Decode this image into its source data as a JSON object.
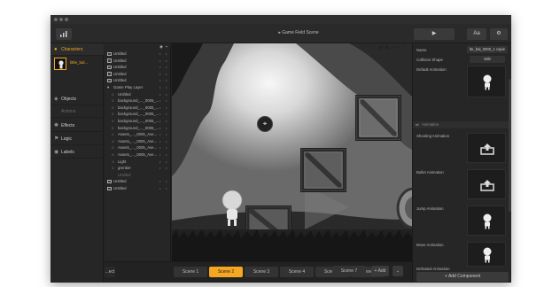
{
  "toolbar": {
    "scene_title": "Game Field Scene",
    "left_icon": "chart-icon",
    "play_icon": "play-icon",
    "text_label": "Aa",
    "settings_icon": "gear-icon"
  },
  "left_panel": {
    "items": [
      {
        "label": "Characters",
        "icon": "person-icon",
        "active": true
      },
      {
        "label": "Objects",
        "icon": "cube-icon"
      },
      {
        "label": "Actions",
        "icon": "none"
      },
      {
        "label": "Effects",
        "icon": "sparkle-icon"
      },
      {
        "label": "Logic",
        "icon": "logic-icon"
      },
      {
        "label": "Labels",
        "icon": "label-icon"
      }
    ],
    "character_name": "little_bal..."
  },
  "layers": {
    "rows": [
      {
        "label": "Untitled",
        "type": "check",
        "indent": 0
      },
      {
        "label": "Untitled",
        "type": "check",
        "indent": 0
      },
      {
        "label": "Untitled",
        "type": "check",
        "indent": 0
      },
      {
        "label": "Untitled",
        "type": "check",
        "indent": 0
      },
      {
        "label": "Untitled",
        "type": "check",
        "indent": 0
      },
      {
        "label": "Game Play Layer",
        "type": "group",
        "indent": 0
      },
      {
        "label": "Untitled",
        "type": "circle",
        "indent": 1
      },
      {
        "label": "background_..._0005_...",
        "type": "circle",
        "indent": 1
      },
      {
        "label": "background_..._0005_...",
        "type": "circle",
        "indent": 1
      },
      {
        "label": "background_..._0005_...",
        "type": "circle",
        "indent": 1
      },
      {
        "label": "background_..._0005_...",
        "type": "circle",
        "indent": 1
      },
      {
        "label": "background_..._0005_...",
        "type": "circle",
        "indent": 1
      },
      {
        "label": "Assets_..._0005_Ave...",
        "type": "circle",
        "indent": 1
      },
      {
        "label": "Assets_..._0005_Ave...",
        "type": "circle",
        "indent": 1
      },
      {
        "label": "Assets_..._0005_Ave...",
        "type": "circle",
        "indent": 1
      },
      {
        "label": "Assets_..._0005_Ave...",
        "type": "circle",
        "indent": 1
      },
      {
        "label": "Light",
        "type": "bulb",
        "indent": 1
      },
      {
        "label": "grenber",
        "type": "circle",
        "indent": 1
      },
      {
        "label": "Untitled",
        "type": "dim",
        "indent": 1
      },
      {
        "label": "Untitled",
        "type": "check",
        "indent": 0
      },
      {
        "label": "Untitled",
        "type": "check",
        "indent": 0
      }
    ]
  },
  "scenes": {
    "tabs": [
      "...ect",
      "Scene 1",
      "Scene 2",
      "Scene 3",
      "Scene 4",
      "Scene 5",
      "Scene 6",
      "Scene 7"
    ],
    "active_index": 2,
    "add_label": "+ Add"
  },
  "inspector": {
    "name_label": "Name",
    "name_value": "lte_bal_0000_1 copie",
    "collision_label": "Collision Shape",
    "collision_value": "Edit",
    "default_anim_label": "Default Animation",
    "section_title": "Animation",
    "animations": [
      "Shooting Animation",
      "Bullet Animation",
      "Jump Animation",
      "Move Animation",
      "Defeated Animation"
    ],
    "add_component": "+ Add Component"
  },
  "colors": {
    "accent": "#f5a623",
    "panel": "#262626",
    "window": "#232323"
  }
}
